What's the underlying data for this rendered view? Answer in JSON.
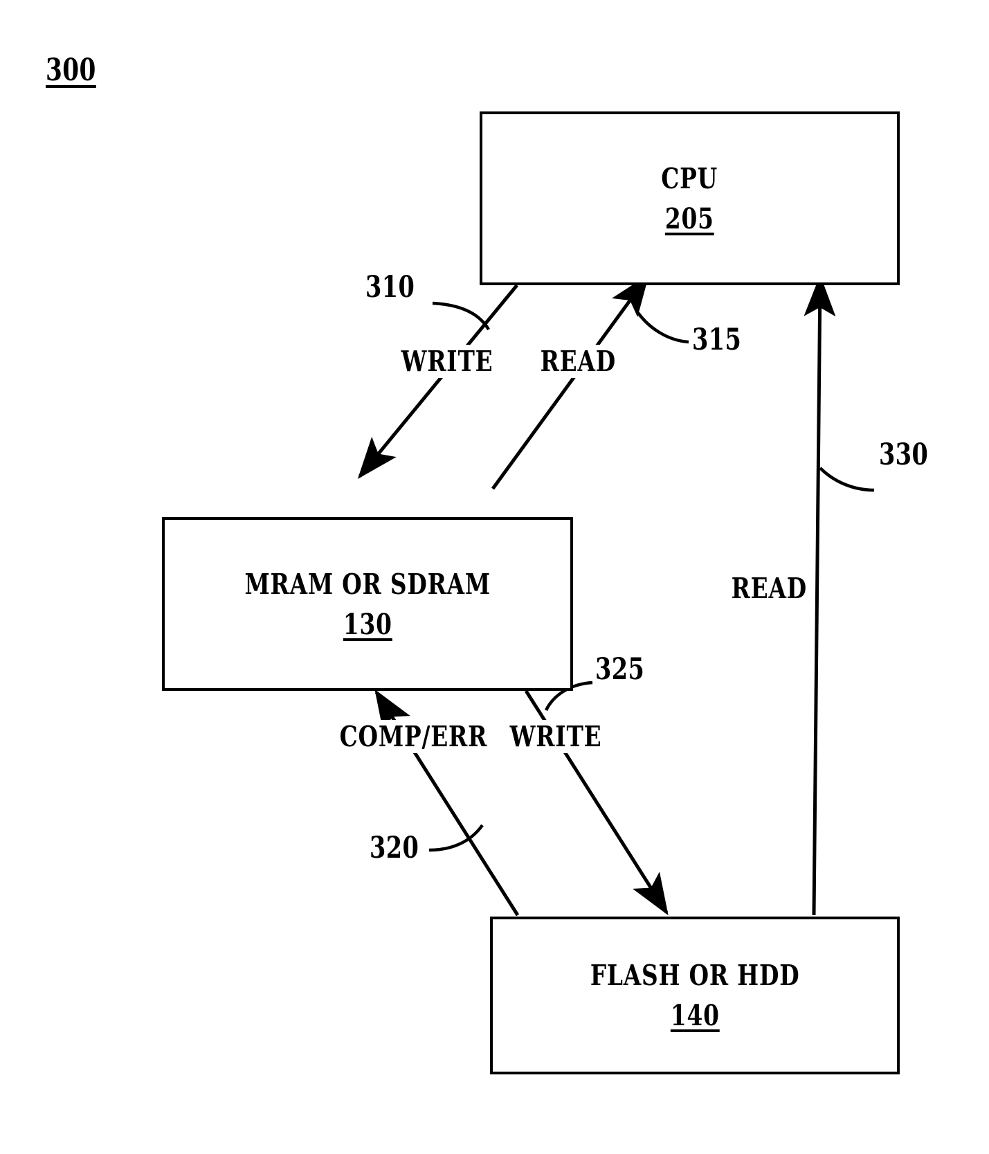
{
  "figure": {
    "number": "300"
  },
  "nodes": [
    {
      "id": "cpu",
      "title": "CPU",
      "ref": "205"
    },
    {
      "id": "mram",
      "title": "MRAM OR SDRAM",
      "ref": "130"
    },
    {
      "id": "flash",
      "title": "FLASH OR HDD",
      "ref": "140"
    }
  ],
  "edges": [
    {
      "id": "write-cpu-to-mram",
      "label": "WRITE",
      "ref": "310",
      "from": "cpu",
      "to": "mram",
      "direction": "down-left"
    },
    {
      "id": "read-mram-to-cpu",
      "label": "READ",
      "ref": "315",
      "from": "mram",
      "to": "cpu",
      "direction": "up-right"
    },
    {
      "id": "comperr-flash-to-mram",
      "label": "COMP/ERR",
      "ref": "320",
      "from": "flash",
      "to": "mram",
      "direction": "up-left"
    },
    {
      "id": "write-mram-to-flash",
      "label": "WRITE",
      "ref": "325",
      "from": "mram",
      "to": "flash",
      "direction": "down-right"
    },
    {
      "id": "read-flash-to-cpu",
      "label": "READ",
      "ref": "330",
      "from": "flash",
      "to": "cpu",
      "direction": "up"
    }
  ],
  "style": {
    "line_color": "#000000",
    "background": "#ffffff"
  }
}
